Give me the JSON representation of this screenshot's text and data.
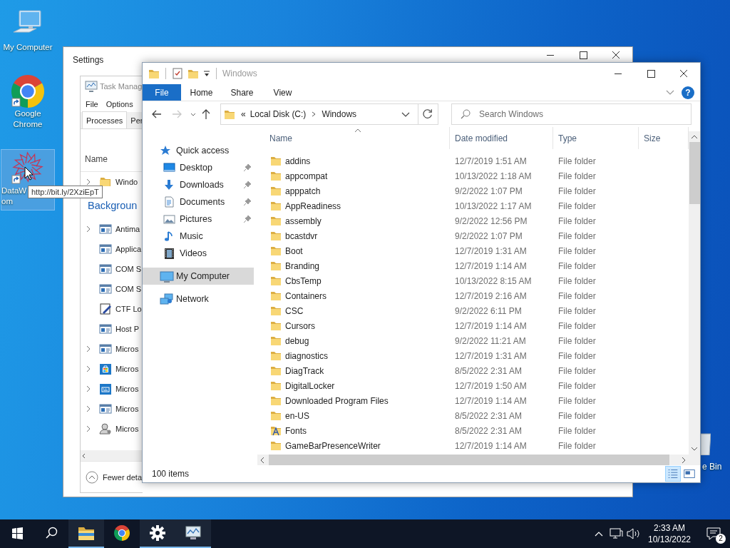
{
  "desktop": {
    "icons": [
      {
        "lines": [
          "My Computer"
        ],
        "kind": "computer",
        "shortcut": false,
        "selected": false
      },
      {
        "lines": [
          "Google",
          "Chrome"
        ],
        "kind": "chrome",
        "shortcut": true,
        "selected": false
      },
      {
        "lines": [
          "DataW",
          "om"
        ],
        "kind": "starburst",
        "shortcut": true,
        "selected": true
      }
    ],
    "tooltip": "http://bit.ly/2XziEpT",
    "recycle_bin_label": "e Bin"
  },
  "settings_window": {
    "title": "Settings"
  },
  "task_manager": {
    "title": "Task Manag",
    "menu": [
      "File",
      "Options"
    ],
    "tabs": [
      {
        "label": "Processes",
        "selected": true
      },
      {
        "label": "Per",
        "selected": false
      }
    ],
    "column": "Name",
    "rows": [
      {
        "kind": "folder",
        "label": "Windo",
        "expandable": true
      },
      {
        "kind": "group",
        "label": "Backgroun"
      },
      {
        "kind": "app",
        "label": "Antima",
        "expandable": true
      },
      {
        "kind": "app",
        "label": "Applica",
        "expandable": false
      },
      {
        "kind": "app",
        "label": "COM S",
        "expandable": false
      },
      {
        "kind": "app",
        "label": "COM S",
        "expandable": false
      },
      {
        "kind": "pen",
        "label": "CTF Lo",
        "expandable": false
      },
      {
        "kind": "app",
        "label": "Host P",
        "expandable": false
      },
      {
        "kind": "app",
        "label": "Micros",
        "expandable": true
      },
      {
        "kind": "store",
        "label": "Micros",
        "expandable": true
      },
      {
        "kind": "keyboard",
        "label": "Micros",
        "expandable": true
      },
      {
        "kind": "app",
        "label": "Micros",
        "expandable": true
      },
      {
        "kind": "user",
        "label": "Micros",
        "expandable": true
      }
    ],
    "footer": "Fewer deta"
  },
  "explorer": {
    "title": "Windows",
    "ribbon_tabs": [
      {
        "label": "File",
        "selected": true
      },
      {
        "label": "Home",
        "selected": false
      },
      {
        "label": "Share",
        "selected": false
      },
      {
        "label": "View",
        "selected": false
      }
    ],
    "help": "?",
    "address": {
      "overflow": "«",
      "segments": [
        "Local Disk (C:)",
        "Windows"
      ]
    },
    "search": {
      "placeholder": "Search Windows"
    },
    "nav": [
      {
        "label": "Quick access",
        "kind": "star",
        "selected": false,
        "children": [
          {
            "label": "Desktop",
            "kind": "desktop",
            "pinned": true,
            "selected": false
          },
          {
            "label": "Downloads",
            "kind": "downloads",
            "pinned": true,
            "selected": false
          },
          {
            "label": "Documents",
            "kind": "documents",
            "pinned": true,
            "selected": false
          },
          {
            "label": "Pictures",
            "kind": "pictures",
            "pinned": true,
            "selected": false
          },
          {
            "label": "Music",
            "kind": "music",
            "pinned": false,
            "selected": false
          },
          {
            "label": "Videos",
            "kind": "videos",
            "pinned": false,
            "selected": false
          }
        ]
      },
      {
        "label": "My Computer",
        "kind": "computer",
        "selected": true
      },
      {
        "label": "Network",
        "kind": "network",
        "selected": false
      }
    ],
    "columns": [
      "Name",
      "Date modified",
      "Type",
      "Size"
    ],
    "rows": [
      {
        "kind": "folder",
        "name": "addins",
        "date": "12/7/2019 1:51 AM",
        "type": "File folder"
      },
      {
        "kind": "folder",
        "name": "appcompat",
        "date": "10/13/2022 1:18 AM",
        "type": "File folder"
      },
      {
        "kind": "folder",
        "name": "apppatch",
        "date": "9/2/2022 1:07 PM",
        "type": "File folder"
      },
      {
        "kind": "folder",
        "name": "AppReadiness",
        "date": "10/13/2022 1:17 AM",
        "type": "File folder"
      },
      {
        "kind": "folder",
        "name": "assembly",
        "date": "9/2/2022 12:56 PM",
        "type": "File folder"
      },
      {
        "kind": "folder",
        "name": "bcastdvr",
        "date": "9/2/2022 1:07 PM",
        "type": "File folder"
      },
      {
        "kind": "folder",
        "name": "Boot",
        "date": "12/7/2019 1:31 AM",
        "type": "File folder"
      },
      {
        "kind": "folder",
        "name": "Branding",
        "date": "12/7/2019 1:14 AM",
        "type": "File folder"
      },
      {
        "kind": "folder",
        "name": "CbsTemp",
        "date": "10/13/2022 8:15 AM",
        "type": "File folder"
      },
      {
        "kind": "folder",
        "name": "Containers",
        "date": "12/7/2019 2:16 AM",
        "type": "File folder"
      },
      {
        "kind": "folder",
        "name": "CSC",
        "date": "9/2/2022 6:11 PM",
        "type": "File folder"
      },
      {
        "kind": "folder",
        "name": "Cursors",
        "date": "12/7/2019 1:14 AM",
        "type": "File folder"
      },
      {
        "kind": "folder",
        "name": "debug",
        "date": "9/2/2022 11:21 AM",
        "type": "File folder"
      },
      {
        "kind": "folder",
        "name": "diagnostics",
        "date": "12/7/2019 1:31 AM",
        "type": "File folder"
      },
      {
        "kind": "folder",
        "name": "DiagTrack",
        "date": "8/5/2022 2:31 AM",
        "type": "File folder"
      },
      {
        "kind": "folder",
        "name": "DigitalLocker",
        "date": "12/7/2019 1:50 AM",
        "type": "File folder"
      },
      {
        "kind": "folder",
        "name": "Downloaded Program Files",
        "date": "12/7/2019 1:14 AM",
        "type": "File folder"
      },
      {
        "kind": "folder",
        "name": "en-US",
        "date": "8/5/2022 2:31 AM",
        "type": "File folder"
      },
      {
        "kind": "fonts",
        "name": "Fonts",
        "date": "8/5/2022 2:31 AM",
        "type": "File folder"
      },
      {
        "kind": "folder",
        "name": "GameBarPresenceWriter",
        "date": "12/7/2019 1:14 AM",
        "type": "File folder"
      }
    ],
    "status": "100 items",
    "views": [
      {
        "kind": "details",
        "selected": true
      },
      {
        "kind": "tiles",
        "selected": false
      }
    ]
  },
  "taskbar": {
    "apps": [
      {
        "kind": "explorer",
        "open": true
      },
      {
        "kind": "chrome",
        "open": false
      },
      {
        "kind": "settings",
        "open": true
      },
      {
        "kind": "taskmgr",
        "open": true
      }
    ],
    "time": "2:33 AM",
    "date": "10/13/2022",
    "notifications": "2"
  }
}
